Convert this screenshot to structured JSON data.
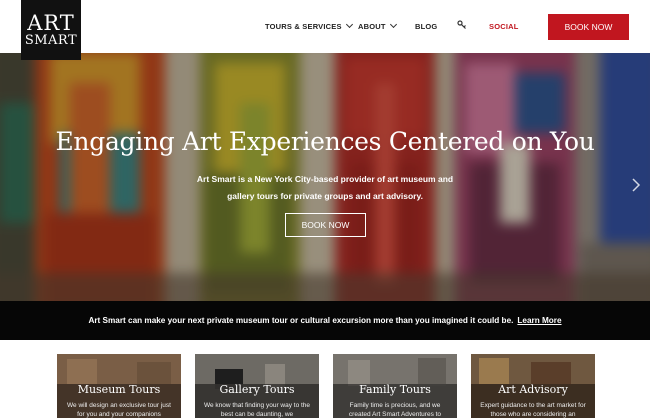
{
  "logo": {
    "line1": "ART",
    "line2": "SMART"
  },
  "nav": {
    "tours": "TOURS & SERVICES",
    "about": "ABOUT",
    "blog": "BLOG",
    "social": "SOCIAL",
    "book": "BOOK NOW"
  },
  "hero": {
    "title": "Engaging Art Experiences Centered on You",
    "text": "Art Smart is a New York City-based provider of art museum and gallery tours for private groups and art advisory.",
    "button": "BOOK NOW"
  },
  "banner": {
    "text": "Art Smart can make your next private museum tour or cultural excursion more than you imagined it could be.",
    "link": "Learn More"
  },
  "cards": [
    {
      "title": "Museum Tours",
      "text": "We will design an exclusive tour just for you and your companions"
    },
    {
      "title": "Gallery Tours",
      "text": "We know that finding your way to the best can be daunting, we"
    },
    {
      "title": "Family Tours",
      "text": "Family time is precious, and we created Art Smart Adventures to"
    },
    {
      "title": "Art Advisory",
      "text": "Expert guidance to the art market for those who are considering an"
    }
  ],
  "colors": {
    "brand_red": "#c1161f",
    "banner_black": "#060606",
    "logo_black": "#111111"
  },
  "icons": {
    "key": "key-icon",
    "next": "chevron-right-icon",
    "dropdown": "chevron-down-icon"
  }
}
